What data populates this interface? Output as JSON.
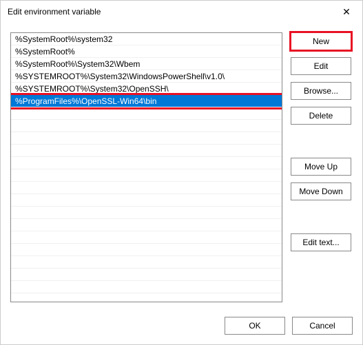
{
  "window": {
    "title": "Edit environment variable",
    "close_glyph": "✕"
  },
  "list": {
    "items": [
      "%SystemRoot%\\system32",
      "%SystemRoot%",
      "%SystemRoot%\\System32\\Wbem",
      "%SYSTEMROOT%\\System32\\WindowsPowerShell\\v1.0\\",
      "%SYSTEMROOT%\\System32\\OpenSSH\\",
      "%ProgramFiles%\\OpenSSL-Win64\\bin"
    ],
    "selected_index": 5,
    "highlighted_index": 5
  },
  "buttons": {
    "new": "New",
    "edit": "Edit",
    "browse": "Browse...",
    "delete": "Delete",
    "move_up": "Move Up",
    "move_down": "Move Down",
    "edit_text": "Edit text...",
    "ok": "OK",
    "cancel": "Cancel"
  },
  "highlighted_button": "new"
}
